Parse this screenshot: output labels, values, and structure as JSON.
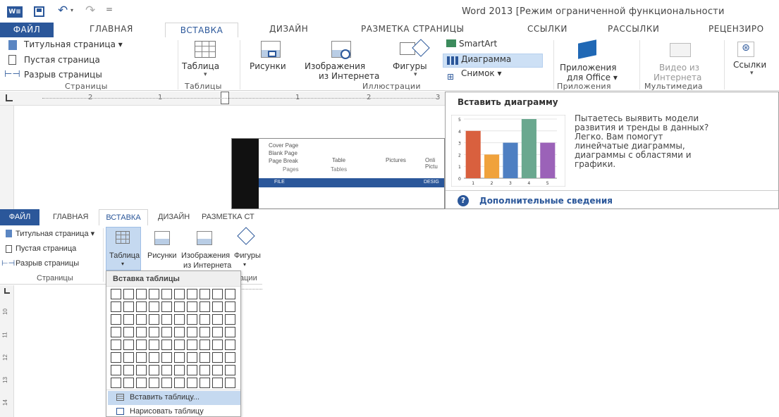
{
  "top": {
    "title": "Word 2013 [Режим ограниченной функциональности",
    "tabs": [
      "ФАЙЛ",
      "ГЛАВНАЯ",
      "ВСТАВКА",
      "ДИЗАЙН",
      "РАЗМЕТКА СТРАНИЦЫ",
      "ССЫЛКИ",
      "РАССЫЛКИ",
      "РЕЦЕНЗИРО"
    ],
    "pages": {
      "title_page": "Титульная страница",
      "blank_page": "Пустая страница",
      "page_break": "Разрыв страницы",
      "group": "Страницы"
    },
    "tables": {
      "table": "Таблица",
      "group": "Таблицы"
    },
    "illustrations": {
      "pictures": "Рисунки",
      "online1": "Изображения",
      "online2": "из Интернета",
      "shapes": "Фигуры",
      "smartart": "SmartArt",
      "chart": "Диаграмма",
      "screenshot": "Снимок",
      "group": "Иллюстрации"
    },
    "apps": {
      "line1": "Приложения",
      "line2": "для Office",
      "group": "Приложения"
    },
    "media": {
      "line1": "Видео из",
      "line2": "Интернета",
      "group": "Мультимедиа"
    },
    "links": {
      "label": "Ссылки"
    },
    "ruler": [
      "2",
      "1",
      "1",
      "2",
      "3"
    ]
  },
  "tooltip": {
    "title": "Вставить диаграмму",
    "text": [
      "Пытаетесь выявить модели",
      "развития и тренды в данных?",
      "Легко. Вам помогут",
      "линейчатые диаграммы,",
      "диаграммы с областями и",
      "графики."
    ],
    "more": "Дополнительные сведения"
  },
  "chart_data": {
    "type": "bar",
    "categories": [
      "1",
      "2",
      "3",
      "4",
      "5"
    ],
    "values": [
      4,
      2,
      3,
      5,
      3
    ],
    "ylim": [
      0,
      5
    ],
    "colors": [
      "#d9603e",
      "#f0a23c",
      "#4e7fc2",
      "#6aa88f",
      "#9b62b8"
    ]
  },
  "thumb": {
    "cover": "Cover Page",
    "blank": "Blank Page",
    "break": "Page Break",
    "pages": "Pages",
    "table": "Table",
    "tables": "Tables",
    "pictures": "Pictures",
    "online": "Onli",
    "pictu": "Pictu",
    "file": "FILE",
    "design": "DESIG"
  },
  "bottom": {
    "tabs": [
      "ФАЙЛ",
      "ГЛАВНАЯ",
      "ВСТАВКА",
      "ДИЗАЙН",
      "РАЗМЕТКА СТ"
    ],
    "title_page": "Титульная страница",
    "blank_page": "Пустая страница",
    "page_break": "Разрыв страницы",
    "pages_group": "Страницы",
    "table": "Таблица",
    "pictures": "Рисунки",
    "online1": "Изображения",
    "online2": "из Интернета",
    "shapes": "Фигуры",
    "illus_partial": "ации",
    "ruler_nums": [
      "10",
      "11",
      "12",
      "13",
      "14"
    ],
    "menu_title": "Вставка таблицы",
    "insert_table": "Вставить таблицу...",
    "draw_table": "Нарисовать таблицу"
  }
}
